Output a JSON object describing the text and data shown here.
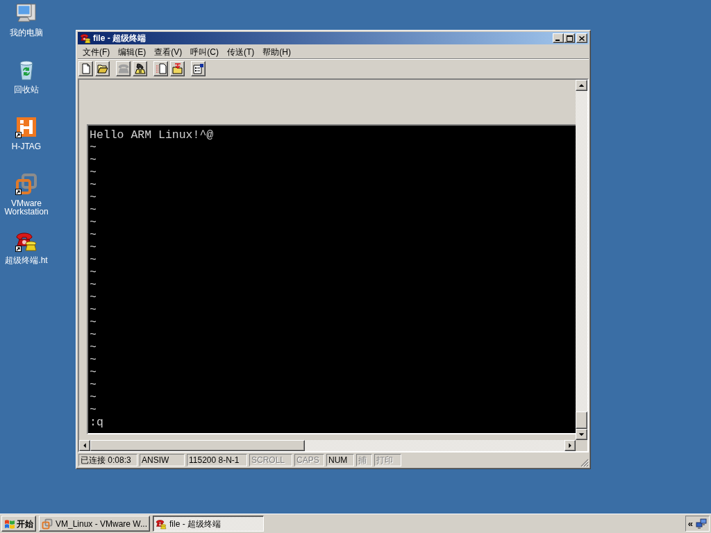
{
  "desktop_icons": [
    {
      "label": "我的电脑",
      "kind": "computer",
      "shortcut": false
    },
    {
      "label": "回收站",
      "kind": "recycle_bin",
      "shortcut": false
    },
    {
      "label": "H-JTAG",
      "kind": "block_logo",
      "shortcut": true
    },
    {
      "label": "VMware Workstation",
      "kind": "squares",
      "shortcut": true
    },
    {
      "label": "超级终端.ht",
      "kind": "phones",
      "shortcut": true
    }
  ],
  "window": {
    "title": "file - 超级终端",
    "menu": [
      "文件(F)",
      "编辑(E)",
      "查看(V)",
      "呼叫(C)",
      "传送(T)",
      "帮助(H)"
    ],
    "toolbar": [
      {
        "buttons": [
          {
            "kind": "new_file",
            "disabled": false
          },
          {
            "kind": "open_folder",
            "disabled": false
          }
        ]
      },
      {
        "buttons": [
          {
            "kind": "phone",
            "disabled": true
          },
          {
            "kind": "hang_up",
            "disabled": false
          }
        ]
      },
      {
        "buttons": [
          {
            "kind": "send_file",
            "disabled": false
          },
          {
            "kind": "receive_file",
            "disabled": false
          }
        ]
      },
      {
        "buttons": [
          {
            "kind": "properties",
            "disabled": false
          }
        ]
      }
    ],
    "terminal": {
      "lines": [
        "Hello ARM Linux!^@",
        "~",
        "~",
        "~",
        "~",
        "~",
        "~",
        "~",
        "~",
        "~",
        "~",
        "~",
        "~",
        "~",
        "~",
        "~",
        "~",
        "~",
        "~",
        "~",
        "~",
        "~",
        "~"
      ],
      "command": ":q"
    },
    "status_bar": [
      {
        "text": "已连接 0:08:3",
        "disabled": false
      },
      {
        "text": "ANSIW",
        "disabled": false
      },
      {
        "text": "115200 8-N-1",
        "disabled": false
      },
      {
        "text": "SCROLL",
        "disabled": true
      },
      {
        "text": "CAPS",
        "disabled": true
      },
      {
        "text": "NUM",
        "disabled": false
      },
      {
        "text": "捕",
        "disabled": true
      },
      {
        "text": "打印",
        "disabled": true
      }
    ]
  },
  "taskbar": {
    "start": "开始",
    "tasks": [
      {
        "label": "VM_Linux - VMware W...",
        "kind": "squares",
        "selected": false
      },
      {
        "label": "file - 超级终端",
        "kind": "phones",
        "selected": true
      }
    ],
    "tray": {
      "expand_button": "«"
    }
  }
}
